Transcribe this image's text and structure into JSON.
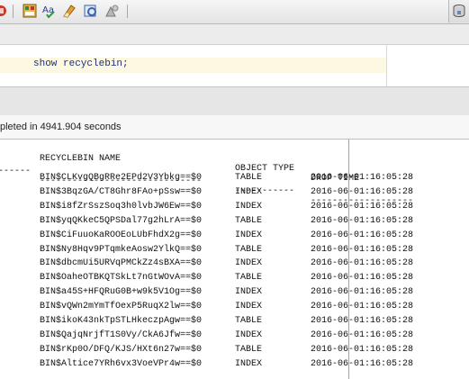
{
  "toolbar": {
    "icons": [
      "red-icon-partial",
      "run-sql-icon",
      "spell-check-icon",
      "clear-icon",
      "explain-plan-icon",
      "autotrace-icon"
    ],
    "right_icon": "database-icon"
  },
  "editor": {
    "code": "show recyclebin;"
  },
  "status": {
    "text": "pleted in 4941.904 seconds"
  },
  "results": {
    "headers": [
      "RECYCLEBIN NAME",
      "OBJECT TYPE",
      "DROP TIME"
    ],
    "left_dashes": "------",
    "dashes": [
      "------------------------------",
      "-----------",
      "-------------------"
    ],
    "rows": [
      {
        "name": "BIN$CLKvgQBgRRe2EPd2V3Ybkg==$0",
        "type": "TABLE",
        "time": "2016-06-01:16:05:28"
      },
      {
        "name": "BIN$3BqzGA/CT8Ghr8FAo+pSsw==$0",
        "type": "INDEX",
        "time": "2016-06-01:16:05:28"
      },
      {
        "name": "BIN$i8fZrSszSoq3h0lvbJW6Ew==$0",
        "type": "INDEX",
        "time": "2016-06-01:16:05:28"
      },
      {
        "name": "BIN$yqQKkeC5QPSDal77g2hLrA==$0",
        "type": "TABLE",
        "time": "2016-06-01:16:05:28"
      },
      {
        "name": "BIN$CiFuuoKaROOEoLUbFhdX2g==$0",
        "type": "INDEX",
        "time": "2016-06-01:16:05:28"
      },
      {
        "name": "BIN$Ny8Hqv9PTqmkeAosw2YlkQ==$0",
        "type": "TABLE",
        "time": "2016-06-01:16:05:28"
      },
      {
        "name": "BIN$dbcmUi5URVqPMCkZz4sBXA==$0",
        "type": "INDEX",
        "time": "2016-06-01:16:05:28"
      },
      {
        "name": "BIN$OaheOTBKQTSkLt7nGtWOvA==$0",
        "type": "TABLE",
        "time": "2016-06-01:16:05:28"
      },
      {
        "name": "BIN$a45S+HFQRuG0B+w9k5V1Og==$0",
        "type": "INDEX",
        "time": "2016-06-01:16:05:28"
      },
      {
        "name": "BIN$vQWn2mYmTfOexP5RuqX2lw==$0",
        "type": "INDEX",
        "time": "2016-06-01:16:05:28"
      },
      {
        "name": "BIN$ikoK43nkTpSTLHkeczpAgw==$0",
        "type": "TABLE",
        "time": "2016-06-01:16:05:28"
      },
      {
        "name": "BIN$QajqNrjfT1S0Vy/CkA6Jfw==$0",
        "type": "INDEX",
        "time": "2016-06-01:16:05:28"
      },
      {
        "name": "BIN$rKp0O/DFQ/KJS/HXt6n27w==$0",
        "type": "TABLE",
        "time": "2016-06-01:16:05:28"
      },
      {
        "name": "BIN$Altice7YRh6vx3VoeVPr4w==$0",
        "type": "INDEX",
        "time": "2016-06-01:16:05:28"
      }
    ]
  }
}
